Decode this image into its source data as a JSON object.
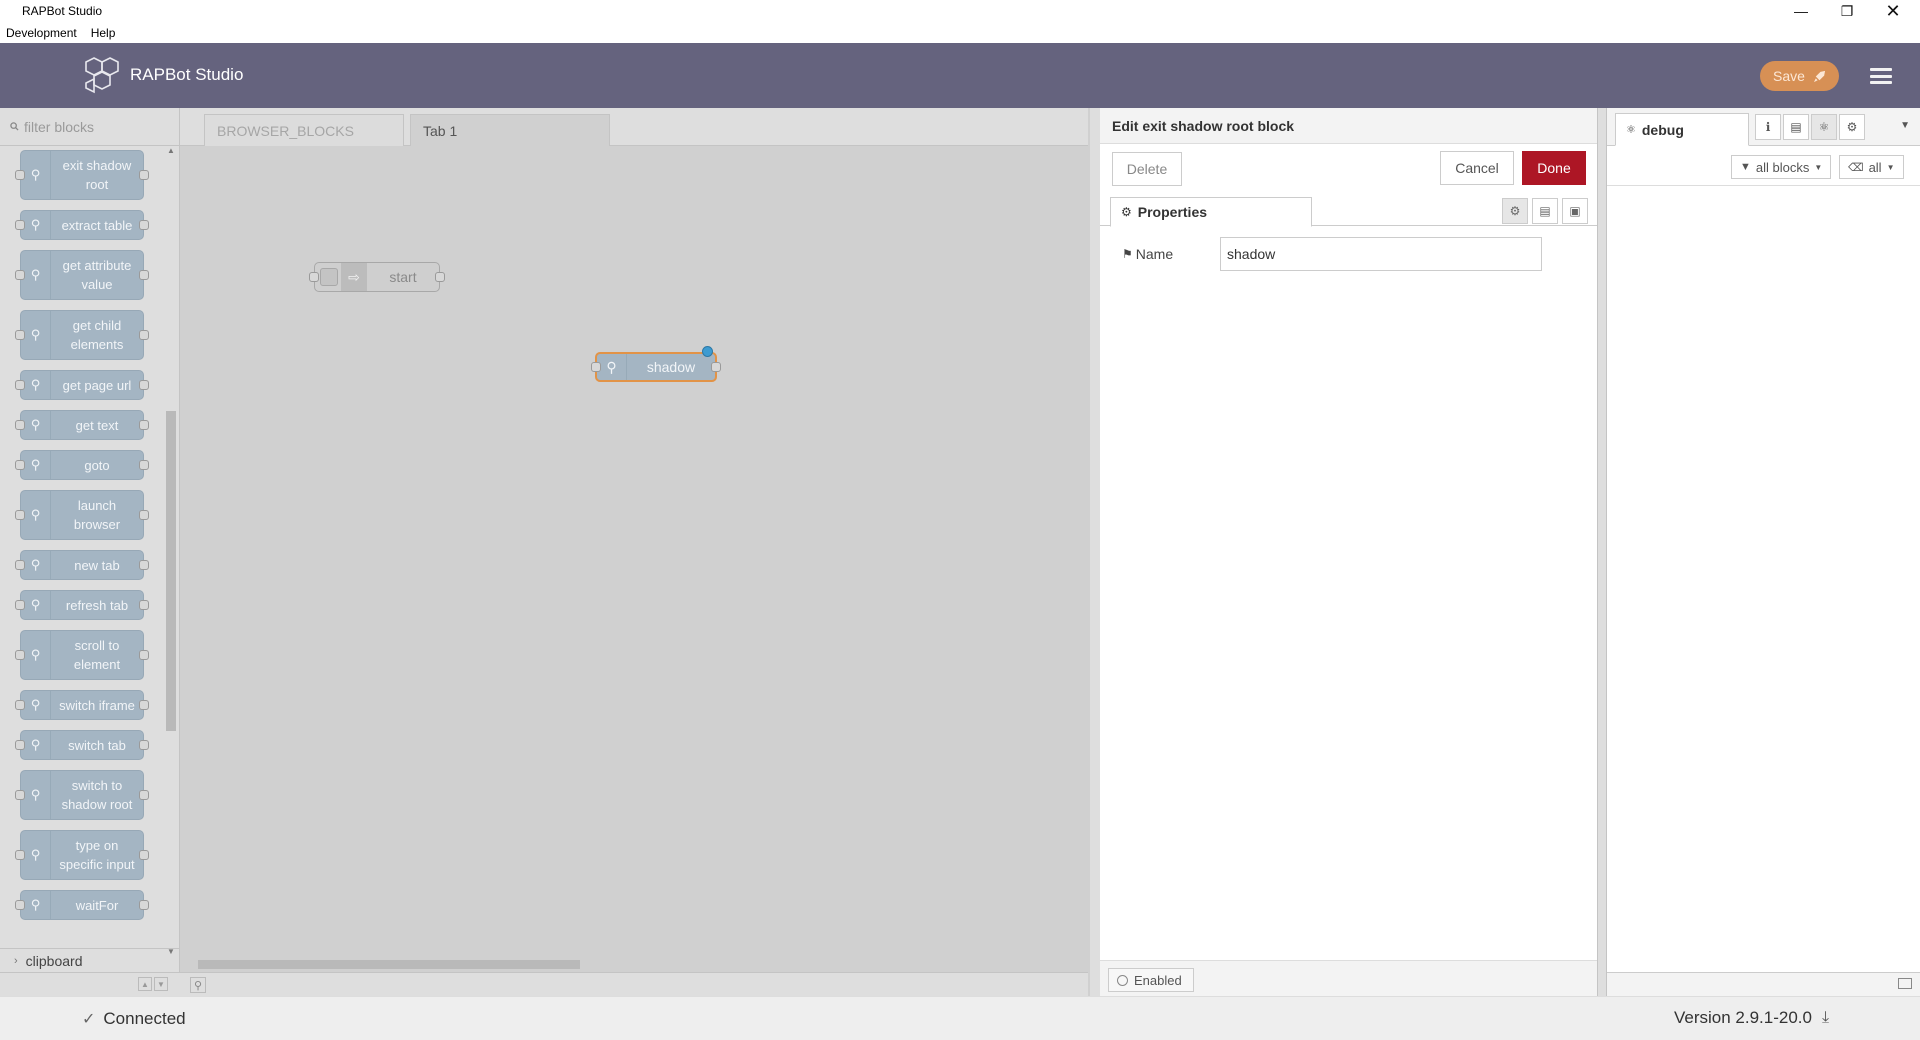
{
  "window": {
    "title": "RAPBot Studio",
    "controls": [
      "minimize",
      "restore",
      "close"
    ]
  },
  "menu": [
    "Development",
    "Help"
  ],
  "header": {
    "app_name": "RAPBot Studio",
    "save_label": "Save",
    "accent_color": "#d79055"
  },
  "palette": {
    "filter_placeholder": "filter blocks",
    "blocks": [
      {
        "label": "exit shadow root"
      },
      {
        "label": "extract table"
      },
      {
        "label": "get attribute value"
      },
      {
        "label": "get child elements"
      },
      {
        "label": "get page url"
      },
      {
        "label": "get text"
      },
      {
        "label": "goto"
      },
      {
        "label": "launch browser"
      },
      {
        "label": "new tab"
      },
      {
        "label": "refresh tab"
      },
      {
        "label": "scroll to element"
      },
      {
        "label": "switch iframe"
      },
      {
        "label": "switch tab"
      },
      {
        "label": "switch to shadow root"
      },
      {
        "label": "type on specific input"
      },
      {
        "label": "waitFor"
      }
    ],
    "category": "clipboard"
  },
  "tabs": [
    "BROWSER_BLOCKS",
    "Tab 1"
  ],
  "canvas": {
    "nodes": [
      {
        "label": "start"
      },
      {
        "label": "shadow"
      }
    ]
  },
  "editor": {
    "title": "Edit exit shadow root block",
    "delete_label": "Delete",
    "cancel_label": "Cancel",
    "done_label": "Done",
    "done_color": "#ad1625",
    "properties_tab": "Properties",
    "name_label": "Name",
    "name_value": "shadow",
    "enabled_label": "Enabled"
  },
  "sidebar": {
    "debug_tab": "debug",
    "filter_blocks": "all blocks",
    "clear_filter": "all"
  },
  "status": {
    "connection": "Connected",
    "version": "Version 2.9.1-20.0"
  }
}
